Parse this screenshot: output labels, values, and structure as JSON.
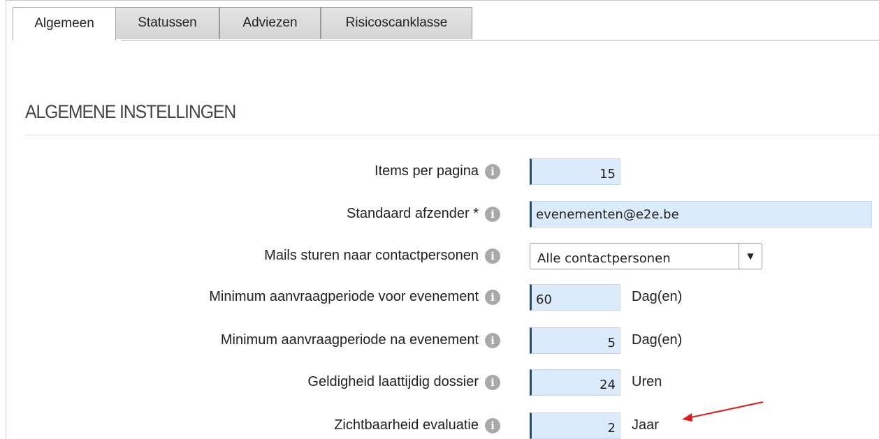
{
  "tabs": [
    {
      "label": "Algemeen",
      "active": true
    },
    {
      "label": "Statussen",
      "active": false
    },
    {
      "label": "Adviezen",
      "active": false
    },
    {
      "label": "Risicoscanklasse",
      "active": false
    }
  ],
  "section": {
    "title": "ALGEMENE INSTELLINGEN"
  },
  "fields": {
    "items_per_page": {
      "label": "Items per pagina",
      "value": "15"
    },
    "default_sender": {
      "label": "Standaard afzender *",
      "value": "evenementen@e2e.be"
    },
    "mail_contacts": {
      "label": "Mails sturen naar contactpersonen",
      "value": "Alle contactpersonen"
    },
    "min_period_before": {
      "label": "Minimum aanvraagperiode voor evenement",
      "value": "60",
      "unit": "Dag(en)"
    },
    "min_period_after": {
      "label": "Minimum aanvraagperiode na evenement",
      "value": "5",
      "unit": "Dag(en)"
    },
    "late_file_validity": {
      "label": "Geldigheid laattijdig dossier",
      "value": "24",
      "unit": "Uren"
    },
    "evaluation_visibility": {
      "label": "Zichtbaarheid evaluatie",
      "value": "2",
      "unit": "Jaar"
    }
  },
  "icons": {
    "info": "info-icon",
    "dropdown": "triangle-down-icon",
    "annotation": "red-arrow"
  },
  "colors": {
    "field_bg": "#dcebfb",
    "field_accent": "#2e4a6a",
    "annotation": "#e01b1b"
  }
}
